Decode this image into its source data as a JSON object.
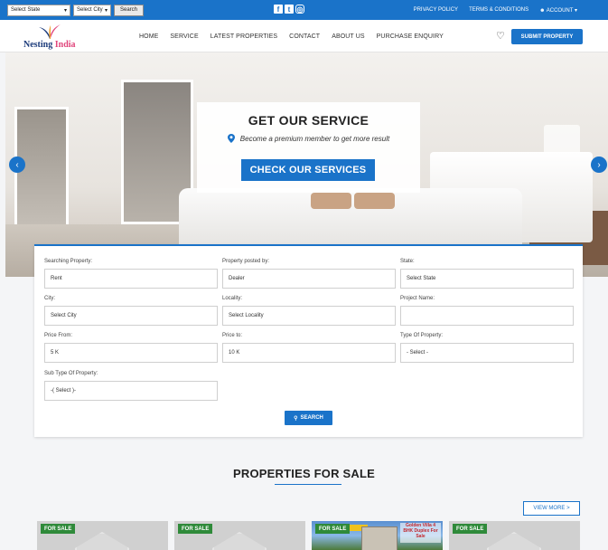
{
  "topbar": {
    "state_select": "Select State",
    "city_select": "Select City",
    "search_label": "Search",
    "links": [
      "PRIVACY POLICY",
      "TERMS & CONDITIONS",
      "ACCOUNT"
    ]
  },
  "nav": {
    "logo_part1": "Nesting",
    "logo_part2": "India",
    "menu": [
      "HOME",
      "SERVICE",
      "LATEST PROPERTIES",
      "CONTACT",
      "ABOUT US",
      "PURCHASE ENQUIRY"
    ],
    "submit_label": "SUBMIT PROPERTY"
  },
  "hero": {
    "title": "GET OUR SERVICE",
    "subtitle": "Become a premium member to get more result",
    "cta": "CHECK OUR SERVICES"
  },
  "form": {
    "fields": [
      {
        "label": "Searching Property:",
        "value": "Rent"
      },
      {
        "label": "Property posted by:",
        "value": "Dealer"
      },
      {
        "label": "State:",
        "value": "Select State"
      },
      {
        "label": "City:",
        "value": "Select City"
      },
      {
        "label": "Locality:",
        "value": "Select Locality"
      },
      {
        "label": "Project Name:",
        "value": ""
      },
      {
        "label": "Price From:",
        "value": "5 K"
      },
      {
        "label": "Price to:",
        "value": "10 K"
      },
      {
        "label": "Type Of Property:",
        "value": "- Select -"
      },
      {
        "label": "Sub Type Of Property:",
        "value": "-( Select )-"
      }
    ],
    "search_label": "SEARCH"
  },
  "properties": {
    "title": "PROPERTIES FOR SALE",
    "view_more": "VIEW MORE >",
    "badge": "FOR SALE",
    "promo": "Golden Villa 4 BHK Duplex For Sale"
  },
  "colors": {
    "primary": "#1a73c9",
    "badge_green": "#2f8a3a"
  }
}
